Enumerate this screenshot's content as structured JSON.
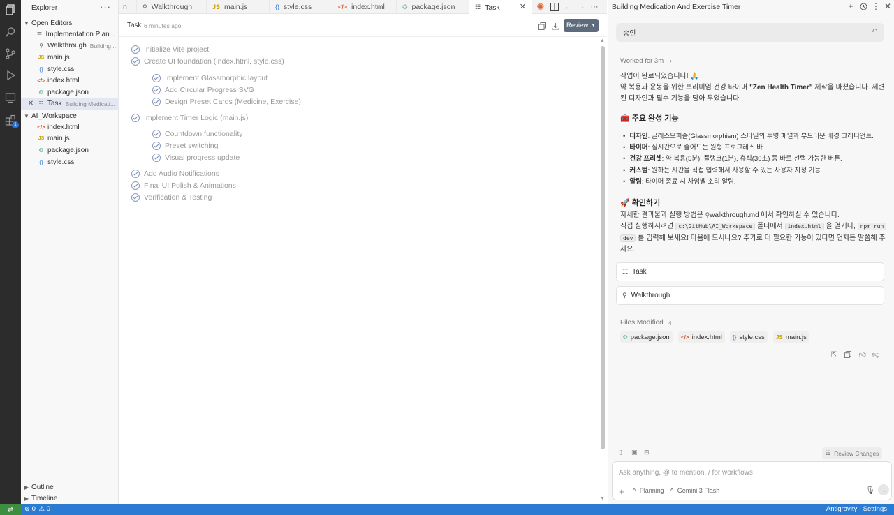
{
  "sidebar": {
    "title": "Explorer",
    "more": "···",
    "open_editors_label": "Open Editors",
    "open_editors": [
      {
        "icon": "md-icon",
        "glyph": "☰",
        "name": "Implementation Plan...",
        "desc": ""
      },
      {
        "icon": "walkthrough-icon",
        "glyph": "⚲",
        "name": "Walkthrough",
        "desc": "Building ..."
      },
      {
        "icon": "js-icon",
        "glyph": "JS",
        "name": "main.js",
        "desc": ""
      },
      {
        "icon": "css-icon",
        "glyph": "{}",
        "name": "style.css",
        "desc": ""
      },
      {
        "icon": "html-icon",
        "glyph": "</>",
        "name": "index.html",
        "desc": ""
      },
      {
        "icon": "json-icon",
        "glyph": "❂",
        "name": "package.json",
        "desc": ""
      },
      {
        "icon": "task-icon",
        "glyph": "☷",
        "name": "Task",
        "desc": "Building Medicati..."
      }
    ],
    "workspace_label": "AI_Workspace",
    "workspace_files": [
      {
        "icon": "html-icon",
        "glyph": "</>",
        "name": "index.html"
      },
      {
        "icon": "js-icon",
        "glyph": "JS",
        "name": "main.js"
      },
      {
        "icon": "json-icon",
        "glyph": "❂",
        "name": "package.json"
      },
      {
        "icon": "css-icon",
        "glyph": "{}",
        "name": "style.css"
      }
    ],
    "outline_label": "Outline",
    "timeline_label": "Timeline"
  },
  "tabs": [
    {
      "label": "n",
      "glyph": ""
    },
    {
      "label": "Walkthrough",
      "glyph": "⚲"
    },
    {
      "label": "main.js",
      "glyph": "JS"
    },
    {
      "label": "style.css",
      "glyph": "{}"
    },
    {
      "label": "index.html",
      "glyph": "</>"
    },
    {
      "label": "package.json",
      "glyph": "❂"
    },
    {
      "label": "Task",
      "glyph": "☷"
    }
  ],
  "editor": {
    "title": "Task",
    "time": "6 minutes ago",
    "review_label": "Review",
    "tasks": [
      {
        "text": "Initialize Vite project",
        "level": 0
      },
      {
        "text": "Create UI foundation (index.html, style.css)",
        "level": 0
      },
      {
        "text": "Implement Glassmorphic layout",
        "level": 1
      },
      {
        "text": "Add Circular Progress SVG",
        "level": 1
      },
      {
        "text": "Design Preset Cards (Medicine, Exercise)",
        "level": 1
      },
      {
        "text": "Implement Timer Logic (main.js)",
        "level": 0
      },
      {
        "text": "Countdown functionality",
        "level": 1
      },
      {
        "text": "Preset switching",
        "level": 1
      },
      {
        "text": "Visual progress update",
        "level": 1
      },
      {
        "text": "Add Audio Notifications",
        "level": 0
      },
      {
        "text": "Final UI Polish & Animations",
        "level": 0
      },
      {
        "text": "Verification & Testing",
        "level": 0
      }
    ]
  },
  "agent": {
    "title": "Building Medication And Exercise Timer",
    "approve_text": "승인",
    "worked_for": "Worked for 3m",
    "done_line": "작업이 완료되었습니다! 🙏",
    "summary_pre": "약 복용과 운동을 위한 프리미엄 건강 타이머 ",
    "summary_bold": "\"Zen Health Timer\"",
    "summary_post": " 제작을 마쳤습니다. 세련",
    "summary_line2": "된 디자인과 필수 기능을 담아 두었습니다.",
    "features_heading": "🧰 주요 완성 기능",
    "features": [
      {
        "label": "디자인",
        "text": ": 글래스모피즘(Glassmorphism) 스타일의 투명 패널과 부드러운 배경 그래디언트."
      },
      {
        "label": "타이머",
        "text": ": 실시간으로 줄어드는 원형 프로그레스 바."
      },
      {
        "label": "건강 프리셋",
        "text": ": 약 복용(5분), 플랭크(1분), 휴식(30초) 등 바로 선택 가능한 버튼."
      },
      {
        "label": "커스텀",
        "text": ": 원하는 시간을 직접 입력해서 사용할 수 있는 사용자 지정 기능."
      },
      {
        "label": "알림",
        "text": ": 타이머 종료 시 차임벨 소리 알림."
      }
    ],
    "check_heading": "🚀 확인하기",
    "check_line1_pre": "자세한 결과물과 실행 방법은 ",
    "check_line1_link": "walkthrough.md",
    "check_line1_post": " 에서 확인하실 수 있습니다.",
    "check_line2_pre": "직접 실행하시려면 ",
    "check_path": "c:\\GitHub\\AI_Workspace",
    "check_line2_mid": " 폴더에서 ",
    "check_file": "index.html",
    "check_line2_post": " 을 열거나, ",
    "check_cmd1": "npm run",
    "check_cmd2": "dev",
    "check_line3_post": " 를 입력해 보세요! 마음에 드시나요? 추가로 더 필요한 기능이 있다면 언제든 말씀해 주",
    "check_line4": "세요.",
    "artifacts": [
      {
        "icon": "task-icon",
        "glyph": "☷",
        "label": "Task"
      },
      {
        "icon": "walkthrough-icon",
        "glyph": "⚲",
        "label": "Walkthrough"
      }
    ],
    "files_modified_label": "Files Modified",
    "files_modified_count": "4",
    "files_modified": [
      {
        "icon": "json-icon",
        "glyph": "❂",
        "label": "package.json"
      },
      {
        "icon": "html-icon",
        "glyph": "</>",
        "label": "index.html"
      },
      {
        "icon": "css-icon",
        "glyph": "{}",
        "label": "style.css"
      },
      {
        "icon": "js-icon",
        "glyph": "JS",
        "label": "main.js"
      }
    ],
    "review_changes": "Review Changes",
    "input_placeholder": "Ask anything, @ to mention, / for workflows",
    "mode": "Planning",
    "model": "Gemini 3 Flash"
  },
  "status": {
    "errors": "0",
    "warnings": "0",
    "right": "Antigravity - Settings"
  },
  "colors": {
    "activity_bar": "#2c2c2c",
    "status_bar": "#2b7bd3",
    "remote": "#3e8e41",
    "review_button": "#5d6b7d"
  }
}
